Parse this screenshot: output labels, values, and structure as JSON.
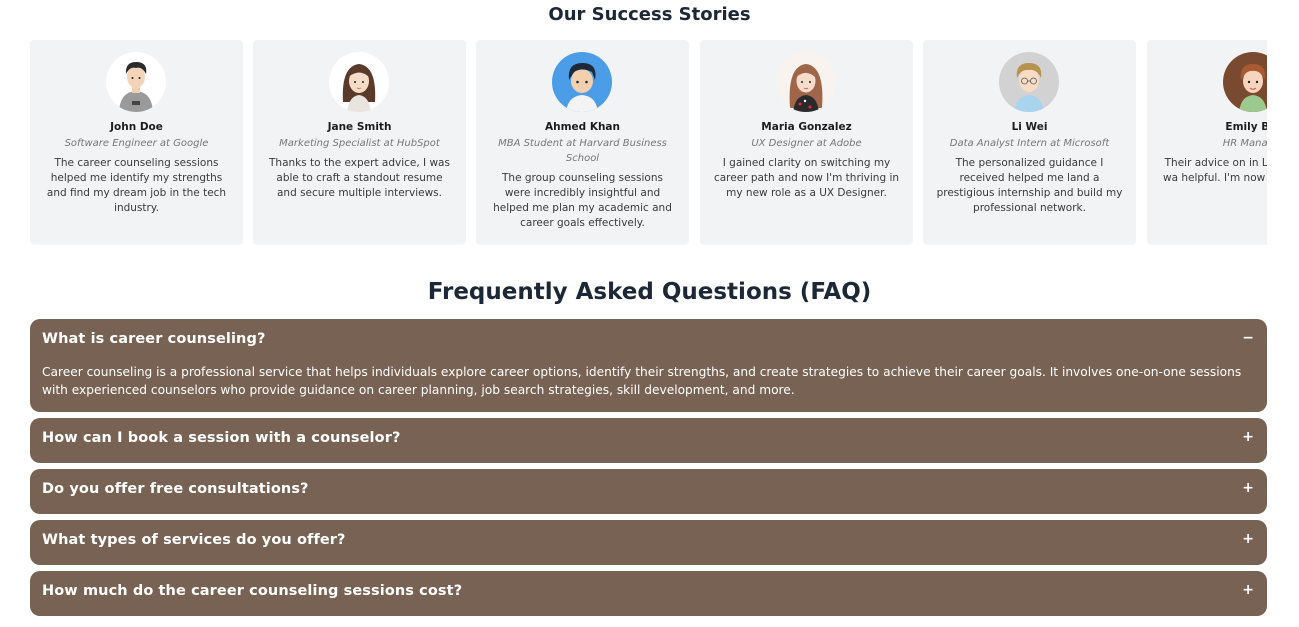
{
  "stories": {
    "title": "Our Success Stories",
    "cards": [
      {
        "name": "John Doe",
        "role": "Software Engineer at Google",
        "text": "The career counseling sessions helped me identify my strengths and find my dream job in the tech industry."
      },
      {
        "name": "Jane Smith",
        "role": "Marketing Specialist at HubSpot",
        "text": "Thanks to the expert advice, I was able to craft a standout resume and secure multiple interviews."
      },
      {
        "name": "Ahmed Khan",
        "role": "MBA Student at Harvard Business School",
        "text": "The group counseling sessions were incredibly insightful and helped me plan my academic and career goals effectively."
      },
      {
        "name": "Maria Gonzalez",
        "role": "UX Designer at Adobe",
        "text": "I gained clarity on switching my career path and now I'm thriving in my new role as a UX Designer."
      },
      {
        "name": "Li Wei",
        "role": "Data Analyst Intern at Microsoft",
        "text": "The personalized guidance I received helped me land a prestigious internship and build my professional network."
      },
      {
        "name": "Emily Bro",
        "role": "HR Manager",
        "text": "Their advice on in LinkedIn profile wa helpful. I'm now gett top recrui"
      }
    ]
  },
  "faq": {
    "title": "Frequently Asked Questions (FAQ)",
    "items": [
      {
        "question": "What is career counseling?",
        "toggle": "−",
        "answer": "Career counseling is a professional service that helps individuals explore career options, identify their strengths, and create strategies to achieve their career goals. It involves one-on-one sessions with experienced counselors who provide guidance on career planning, job search strategies, skill development, and more."
      },
      {
        "question": "How can I book a session with a counselor?",
        "toggle": "+"
      },
      {
        "question": "Do you offer free consultations?",
        "toggle": "+"
      },
      {
        "question": "What types of services do you offer?",
        "toggle": "+"
      },
      {
        "question": "How much do the career counseling sessions cost?",
        "toggle": "+"
      }
    ]
  },
  "colors": {
    "faq_bg": "#786253",
    "title": "#1c2836",
    "card_bg": "#f2f3f5"
  }
}
